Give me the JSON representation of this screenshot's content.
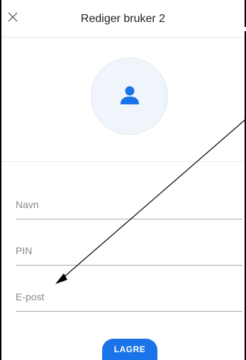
{
  "header": {
    "title": "Rediger bruker 2",
    "close_icon": "close-icon"
  },
  "avatar": {
    "icon": "user-icon",
    "accent_color": "#1a73e8"
  },
  "form": {
    "name_label": "Navn",
    "pin_label": "PIN",
    "email_label": "E-post"
  },
  "actions": {
    "save_label": "LAGRE",
    "save_color": "#1a73e8"
  }
}
